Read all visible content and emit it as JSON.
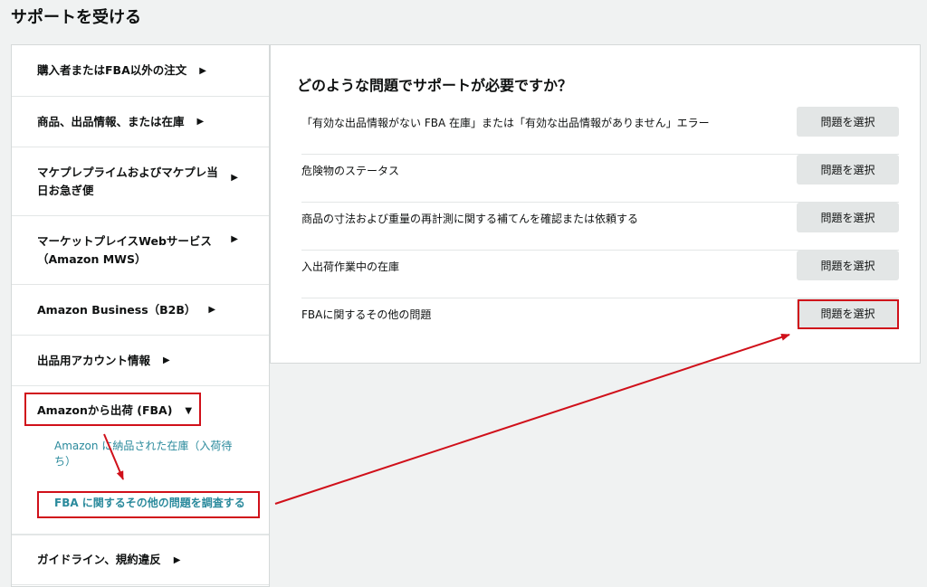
{
  "page": {
    "title": "サポートを受ける"
  },
  "sidebar": {
    "categories": [
      {
        "label": "購入者またはFBA以外の注文",
        "arrow": "▶"
      },
      {
        "label": "商品、出品情報、または在庫",
        "arrow": "▶"
      },
      {
        "label_line1": "マケプレプライムおよびマケプレ当",
        "label_line2": "日お急ぎ便",
        "arrow": "▶"
      },
      {
        "label_line1": "マーケットプレイスWebサービス",
        "label_line2": "（Amazon MWS）",
        "arrow": "▶"
      },
      {
        "label": "Amazon Business（B2B）",
        "arrow": "▶"
      },
      {
        "label": "出品用アカウント情報",
        "arrow": "▶"
      },
      {
        "label": "Amazonから出荷 (FBA)",
        "arrow": "▼",
        "expanded": true,
        "subitems": [
          {
            "label_line1": "Amazon に納品された在庫（入荷待",
            "label_line2": "ち）"
          },
          {
            "label": "FBA に関するその他の問題を調査する"
          }
        ]
      },
      {
        "label": "ガイドライン、規約違反",
        "arrow": "▶"
      }
    ]
  },
  "main": {
    "heading": "どのような問題でサポートが必要ですか？",
    "select_label": "問題を選択",
    "issues": [
      {
        "label": "「有効な出品情報がない FBA 在庫」または「有効な出品情報がありません」エラー"
      },
      {
        "label": "危険物のステータス"
      },
      {
        "label": "商品の寸法および重量の再計測に関する補てんを確認または依頼する"
      },
      {
        "label": "入出荷作業中の在庫"
      },
      {
        "label": "FBAに関するその他の問題"
      }
    ]
  },
  "colors": {
    "highlight": "#d0101a",
    "link": "#2a8a9c",
    "button": "#e3e6e6",
    "background": "#f0f2f2"
  }
}
